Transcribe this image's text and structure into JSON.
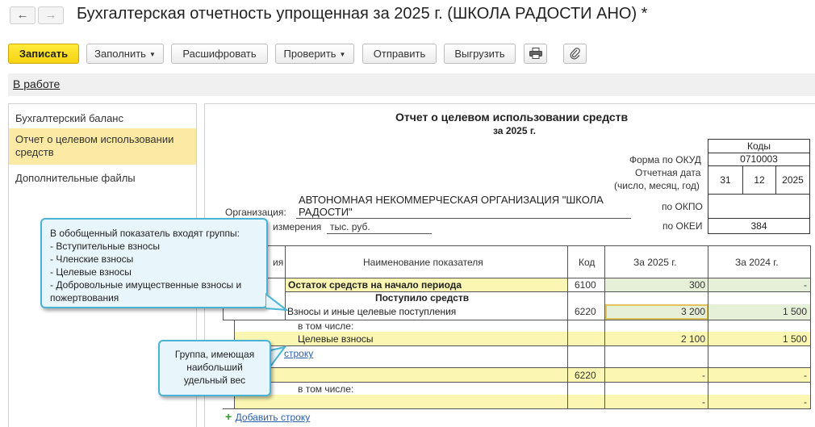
{
  "window": {
    "title": "Бухгалтерская отчетность упрощенная за 2025 г. (ШКОЛА РАДОСТИ АНО) *"
  },
  "toolbar": {
    "save": "Записать",
    "fill": "Заполнить",
    "decode": "Расшифровать",
    "check": "Проверить",
    "send": "Отправить",
    "export": "Выгрузить"
  },
  "status": {
    "link": "В работе"
  },
  "sidebar": {
    "items": [
      {
        "label": "Бухгалтерский баланс"
      },
      {
        "label": "Отчет о целевом использовании средств"
      },
      {
        "label": "Дополнительные файлы"
      }
    ]
  },
  "report": {
    "title": "Отчет о целевом использовании средств",
    "subtitle": "за 2025 г.",
    "codes_header": "Коды",
    "form_okud_label": "Форма по ОКУД",
    "form_okud_value": "0710003",
    "report_date_label": "Отчетная дата",
    "report_date_hint": "(число, месяц, год)",
    "date_day": "31",
    "date_month": "12",
    "date_year": "2025",
    "org_label": "Организация:",
    "org_name": "АВТОНОМНАЯ НЕКОММЕРЧЕСКАЯ ОРГАНИЗАЦИЯ \"ШКОЛА РАДОСТИ\"",
    "okpo_label": "по ОКПО",
    "okpo_value": "",
    "unit_label": "измерения",
    "unit_value": "тыс. руб.",
    "okei_label": "по ОКЕИ",
    "okei_value": "384",
    "table": {
      "col_note": "ия",
      "col_name": "Наименование показателя",
      "col_code": "Код",
      "col_2025": "За 2025 г.",
      "col_2024": "За 2024 г."
    },
    "rows": {
      "opening_name": "Остаток средств на начало периода",
      "opening_code": "6100",
      "opening_2025": "300",
      "opening_2024": "-",
      "received_heading": "Поступило средств",
      "contrib_name": "Взносы и иные целевые поступления",
      "contrib_code": "6220",
      "contrib_2025": "3 200",
      "contrib_2024": "1 500",
      "incl_label": "в том числе:",
      "target_name": "Целевые взносы",
      "target_2025": "2 100",
      "target_2024": "1 500",
      "add_row_partial": "строку",
      "second_code": "6220",
      "second_2025": "-",
      "second_2024": "-",
      "incl_label2": "в том числе:",
      "second_sub_2025": "-",
      "second_sub_2024": "-",
      "add_row": "Добавить строку"
    }
  },
  "tooltips": {
    "groups_title": "В обобщенный показатель входят группы:",
    "groups_items": [
      "- Вступительные взносы",
      "- Членские взносы",
      "- Целевые взносы",
      "- Добровольные имущественные взносы и",
      "пожертвования"
    ],
    "weight": "Группа, имеющая наибольший удельный вес"
  },
  "colors": {
    "primary_button": "#f6d313",
    "highlight_row": "#fbf7b2",
    "value_cell": "#e6efd8",
    "tooltip_border": "#49b3d6",
    "link": "#2b5fa8"
  }
}
